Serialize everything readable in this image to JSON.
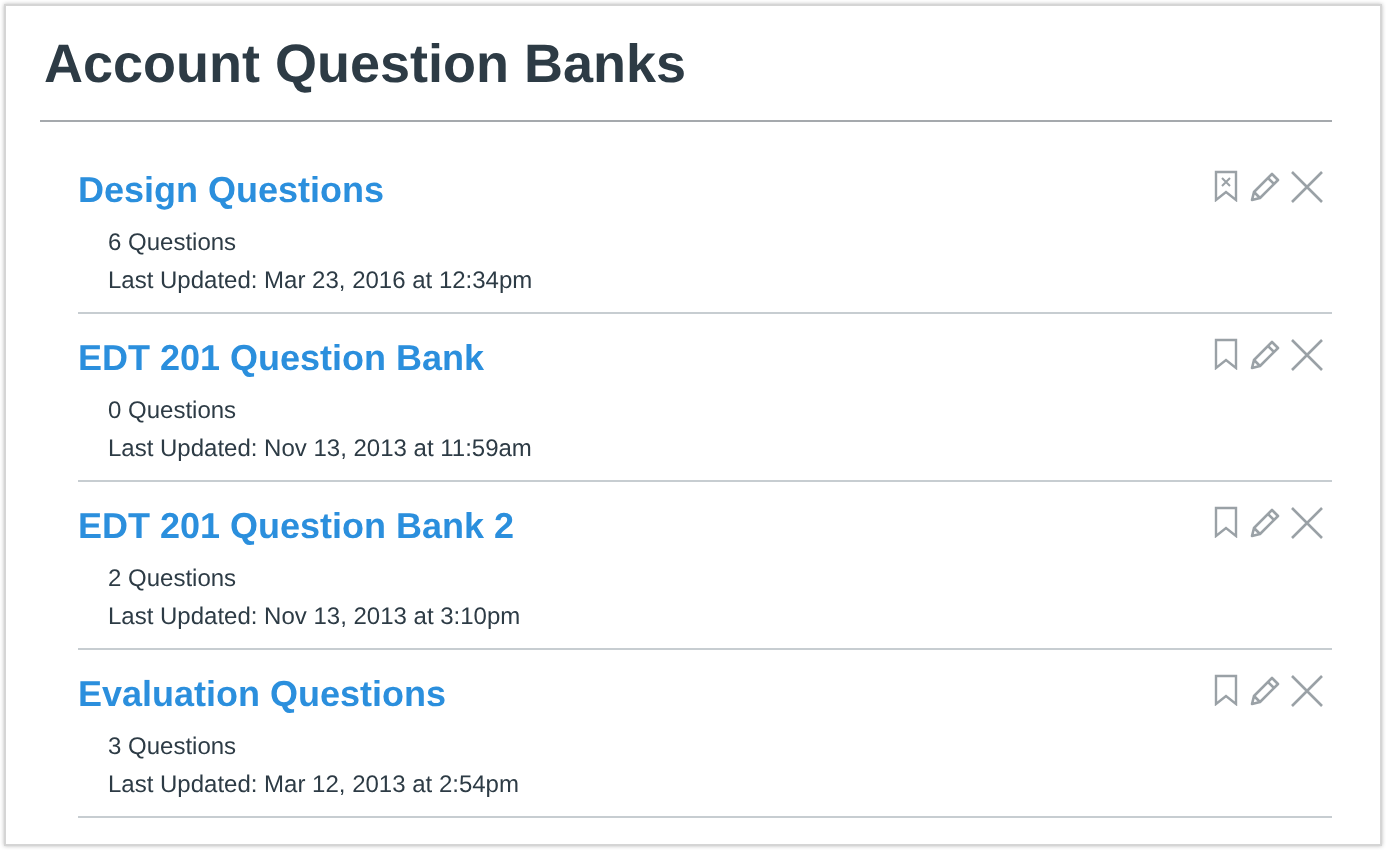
{
  "page": {
    "title": "Account Question Banks"
  },
  "banks": [
    {
      "name": "Design Questions",
      "count": "6 Questions",
      "updated": "Last Updated: Mar 23, 2016 at 12:34pm",
      "bookmarked": true
    },
    {
      "name": "EDT 201 Question Bank",
      "count": "0 Questions",
      "updated": "Last Updated: Nov 13, 2013 at 11:59am",
      "bookmarked": false
    },
    {
      "name": "EDT 201 Question Bank 2",
      "count": "2 Questions",
      "updated": "Last Updated: Nov 13, 2013 at 3:10pm",
      "bookmarked": false
    },
    {
      "name": "Evaluation Questions",
      "count": "3 Questions",
      "updated": "Last Updated: Mar 12, 2013 at 2:54pm",
      "bookmarked": false
    }
  ]
}
